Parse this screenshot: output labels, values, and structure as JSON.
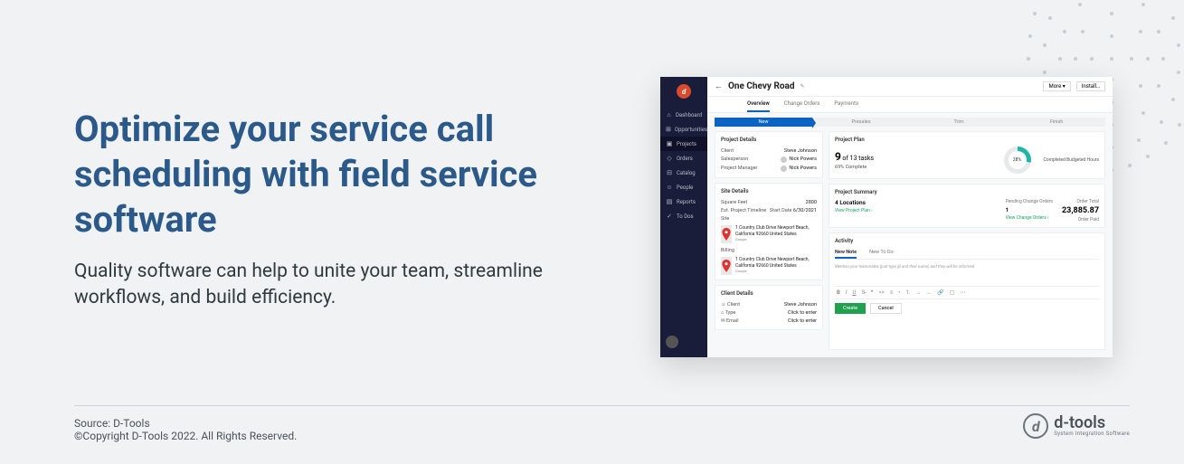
{
  "hero": {
    "title": "Optimize your service call scheduling with field service software",
    "subtitle": "Quality software can help to unite your team, streamline workflows, and build efficiency."
  },
  "footer": {
    "source": "Source: D-Tools",
    "copyright": "©Copyright D-Tools 2022. All Rights Reserved.",
    "brand_name": "d-tools",
    "brand_tag": "System Integration Software"
  },
  "app": {
    "sidebar": {
      "items": [
        {
          "icon": "⌂",
          "label": "Dashboard"
        },
        {
          "icon": "⊞",
          "label": "Opportunities"
        },
        {
          "icon": "▣",
          "label": "Projects"
        },
        {
          "icon": "◇",
          "label": "Orders"
        },
        {
          "icon": "⊟",
          "label": "Catalog"
        },
        {
          "icon": "☺",
          "label": "People"
        },
        {
          "icon": "▤",
          "label": "Reports"
        },
        {
          "icon": "✓",
          "label": "To Dos"
        }
      ],
      "active_index": 2
    },
    "header": {
      "back": "←",
      "title": "One Chevy Road",
      "edit_icon": "✎",
      "more_label": "More ▾",
      "install_label": "Install…"
    },
    "tabs": [
      "Overview",
      "Change Orders",
      "Payments"
    ],
    "active_tab": 0,
    "stepper": [
      "New",
      "Presales",
      "Trim",
      "Finish"
    ],
    "active_step": 0,
    "project_details": {
      "title": "Project Details",
      "rows": [
        {
          "k": "Client",
          "v": "Steve Johnson"
        },
        {
          "k": "Salesperson",
          "v": "Nick Powers",
          "avatar": true
        },
        {
          "k": "Project Manager",
          "v": "Nick Powers",
          "avatar": true
        }
      ]
    },
    "site_details": {
      "title": "Site Details",
      "sqft_label": "Square Feet",
      "sqft_value": "2800",
      "timeline_label": "Est. Project Timeline",
      "start_label": "Start Date",
      "start_value": "6/30/2021",
      "site_label": "Site",
      "billing_label": "Billing",
      "address": "1 Country Club Drive Newport Beach, California 92660 United States",
      "map_provider": "Google"
    },
    "client_details": {
      "title": "Client Details",
      "rows": [
        {
          "icon": "☺",
          "k": "Client",
          "v": "Steve Johnson"
        },
        {
          "icon": "⌂",
          "k": "Type",
          "v": "Click to enter"
        },
        {
          "icon": "✉",
          "k": "Email",
          "v": "Click to enter"
        }
      ]
    },
    "plan": {
      "title": "Project Plan",
      "done": "9",
      "total": "of 13 tasks",
      "sub": "69% Complete",
      "ring": "28%",
      "ring_label": "Completed Budgeted Hours"
    },
    "summary": {
      "title": "Project Summary",
      "loc_label": "4 Locations",
      "loc_link": "View Project Plan ›",
      "pco_label": "Pending Change Orders",
      "pco_value": "1",
      "pco_link": "View Change Orders ›",
      "price_label": "Order Total",
      "price": "23,885.87",
      "price_sub": "Order Paid"
    },
    "activity": {
      "title": "Activity",
      "tabs": [
        "New Note",
        "New To Do"
      ],
      "placeholder": "Mention your teammates (just type @ and their name) and they will be informed",
      "create": "Create",
      "cancel": "Cancel"
    }
  }
}
